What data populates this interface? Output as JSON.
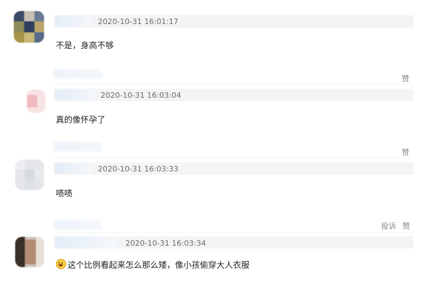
{
  "comments": [
    {
      "timestamp": "2020-10-31 16:01:17",
      "text": "不是，身高不够"
    },
    {
      "timestamp": "2020-10-31 16:03:04",
      "text": "真的像怀孕了",
      "like_label": "赞"
    },
    {
      "timestamp": "2020-10-31 16:03:33",
      "text": "啧啧",
      "like_label": "赞"
    },
    {
      "timestamp": "2020-10-31 16:03:34",
      "text": "这个比例看起来怎么那么矮，像小孩偷穿大人衣服",
      "emoji": "grinning-face-emoji",
      "report_label": "投诉",
      "like_label": "赞"
    }
  ],
  "actions_top": {
    "like_label": "赞"
  },
  "colors": {
    "timestamp": "#6b6b6b",
    "action": "#8a8a8a",
    "meta_strip": "#f3f4f6"
  }
}
